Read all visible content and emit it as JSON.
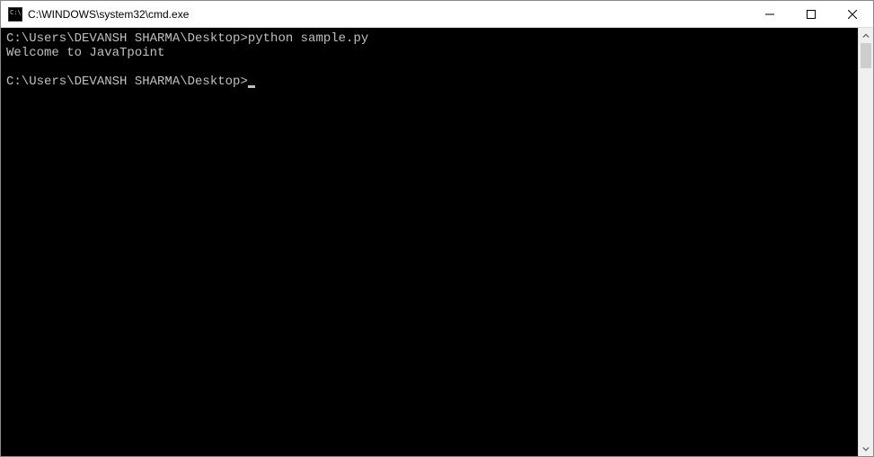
{
  "titlebar": {
    "title": "C:\\WINDOWS\\system32\\cmd.exe"
  },
  "console": {
    "lines": [
      {
        "prompt": "C:\\Users\\DEVANSH SHARMA\\Desktop>",
        "command": "python sample.py"
      },
      {
        "output": "Welcome to JavaTpoint"
      },
      {
        "blank": true
      },
      {
        "prompt": "C:\\Users\\DEVANSH SHARMA\\Desktop>",
        "cursor": true
      }
    ]
  }
}
